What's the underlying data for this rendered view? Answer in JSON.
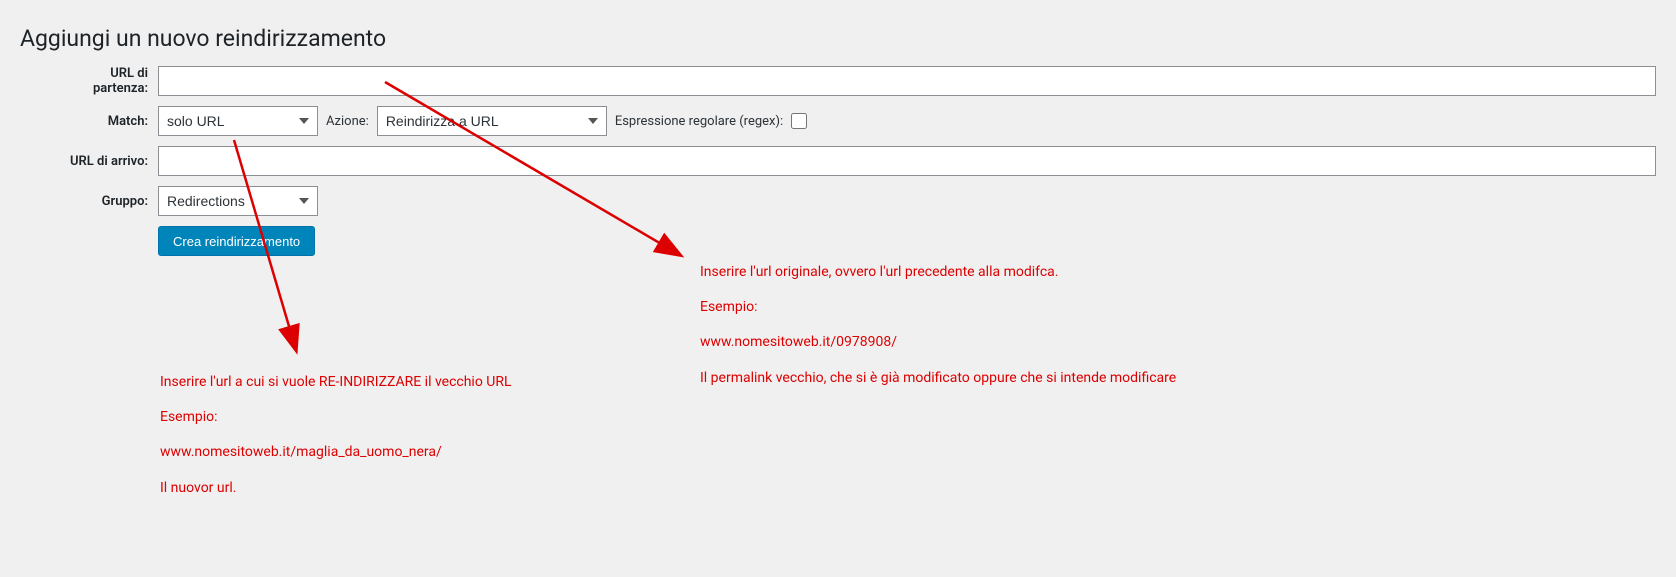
{
  "page": {
    "title": "Aggiungi un nuovo reindirizzamento"
  },
  "form": {
    "url_partenza": {
      "label": "URL di\npartenza:",
      "value": ""
    },
    "match": {
      "label": "Match:",
      "selected": "solo URL"
    },
    "azione": {
      "label": "Azione:",
      "selected": "Reindirizza a URL"
    },
    "regex": {
      "label": "Espressione regolare (regex):",
      "checked": false
    },
    "url_arrivo": {
      "label": "URL di arrivo:",
      "value": ""
    },
    "gruppo": {
      "label": "Gruppo:",
      "selected": "Redirections"
    },
    "submit": {
      "label": "Crea reindirizzamento"
    }
  },
  "annotations": {
    "right": {
      "line1": "Inserire l'url originale, ovvero l'url precedente alla modifca.",
      "line2": "Esempio:",
      "line3": "www.nomesitoweb.it/0978908/",
      "line4": "Il permalink vecchio, che si è già modificato oppure che si intende modificare"
    },
    "left": {
      "line1": "Inserire l'url a cui si vuole RE-INDIRIZZARE il vecchio URL",
      "line2": "Esempio:",
      "line3": "www.nomesitoweb.it/maglia_da_uomo_nera/",
      "line4": "Il nuovor url."
    }
  }
}
